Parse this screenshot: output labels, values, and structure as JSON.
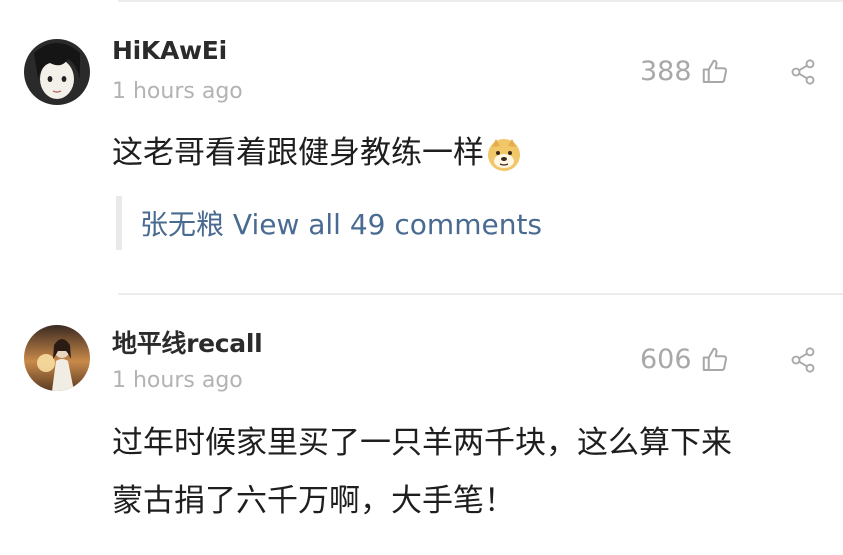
{
  "comments": [
    {
      "username": "HiKAwEi",
      "time": "1 hours ago",
      "likes": "388",
      "content": "这老哥看着跟健身教练一样",
      "emoji": "doge-emoji",
      "reply_link": "张无粮 View all 49 comments"
    },
    {
      "username": "地平线recall",
      "time": "1 hours ago",
      "likes": "606",
      "content_lines": [
        "过年时候家里买了一只羊两千块，这么算下来",
        "蒙古捐了六千万啊，大手笔！"
      ]
    }
  ],
  "icons": {
    "like": "thumbs-up-icon",
    "share": "share-icon"
  },
  "colors": {
    "link": "#4a6b91",
    "meta": "#b3b3b3",
    "likes": "#a8a8a8",
    "divider": "#ececec"
  }
}
